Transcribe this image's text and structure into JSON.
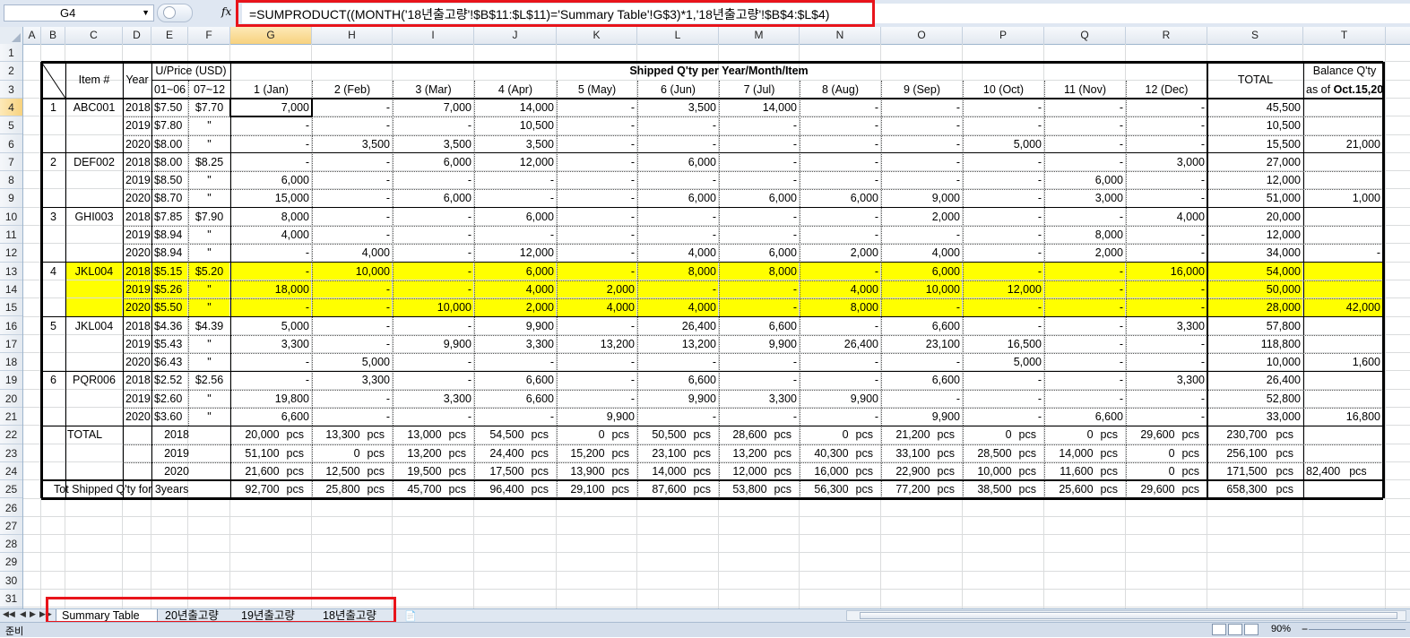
{
  "formula_bar": {
    "name_box": "G4",
    "fx_label": "fx",
    "formula": "=SUMPRODUCT((MONTH('18년출고량'!$B$11:$L$11)='Summary Table'!G$3)*1,'18년출고량'!$B$4:$L$4)"
  },
  "columns": [
    "A",
    "B",
    "C",
    "D",
    "E",
    "F",
    "G",
    "H",
    "I",
    "J",
    "K",
    "L",
    "M",
    "N",
    "O",
    "P",
    "Q",
    "R",
    "S",
    "T"
  ],
  "rows": [
    "1",
    "2",
    "3",
    "4",
    "5",
    "6",
    "7",
    "8",
    "9",
    "10",
    "11",
    "12",
    "13",
    "14",
    "15",
    "16",
    "17",
    "18",
    "19",
    "20",
    "21",
    "22",
    "23",
    "24",
    "25",
    "26",
    "27",
    "28",
    "29",
    "30",
    "31"
  ],
  "selected": {
    "column": "G",
    "row": "4"
  },
  "table": {
    "header": {
      "item_no": "Item #",
      "year": "Year",
      "uprice": "U/Price (USD)",
      "uprice_sub1": "01~06",
      "uprice_sub2": "07~12",
      "shipped_title": "Shipped Q'ty per Year/Month/Item",
      "months": [
        "1 (Jan)",
        "2 (Feb)",
        "3 (Mar)",
        "4 (Apr)",
        "5 (May)",
        "6 (Jun)",
        "7 (Jul)",
        "8 (Aug)",
        "9 (Sep)",
        "10 (Oct)",
        "11 (Nov)",
        "12 (Dec)"
      ],
      "total": "TOTAL",
      "balance": "Balance Q'ty",
      "balance_asof_prefix": "as of ",
      "balance_asof_date": "Oct.15,20"
    },
    "rows": [
      {
        "no": "1",
        "item": "ABC001",
        "year": "2018",
        "p1": "$7.50",
        "p2": "$7.70",
        "m": [
          "7,000",
          "-",
          "7,000",
          "14,000",
          "-",
          "3,500",
          "14,000",
          "-",
          "-",
          "-",
          "-",
          "-"
        ],
        "total": "45,500",
        "bal": ""
      },
      {
        "no": "",
        "item": "",
        "year": "2019",
        "p1": "$7.80",
        "p2": "\"",
        "m": [
          "-",
          "-",
          "-",
          "10,500",
          "-",
          "-",
          "-",
          "-",
          "-",
          "-",
          "-",
          "-"
        ],
        "total": "10,500",
        "bal": ""
      },
      {
        "no": "",
        "item": "",
        "year": "2020",
        "p1": "$8.00",
        "p2": "\"",
        "m": [
          "-",
          "3,500",
          "3,500",
          "3,500",
          "-",
          "-",
          "-",
          "-",
          "-",
          "5,000",
          "-",
          "-"
        ],
        "total": "15,500",
        "bal": "21,000"
      },
      {
        "no": "2",
        "item": "DEF002",
        "year": "2018",
        "p1": "$8.00",
        "p2": "$8.25",
        "m": [
          "-",
          "-",
          "6,000",
          "12,000",
          "-",
          "6,000",
          "-",
          "-",
          "-",
          "-",
          "-",
          "3,000"
        ],
        "total": "27,000",
        "bal": ""
      },
      {
        "no": "",
        "item": "",
        "year": "2019",
        "p1": "$8.50",
        "p2": "\"",
        "m": [
          "6,000",
          "-",
          "-",
          "-",
          "-",
          "-",
          "-",
          "-",
          "-",
          "-",
          "6,000",
          "-"
        ],
        "total": "12,000",
        "bal": ""
      },
      {
        "no": "",
        "item": "",
        "year": "2020",
        "p1": "$8.70",
        "p2": "\"",
        "m": [
          "15,000",
          "-",
          "6,000",
          "-",
          "-",
          "6,000",
          "6,000",
          "6,000",
          "9,000",
          "-",
          "3,000",
          "-"
        ],
        "total": "51,000",
        "bal": "1,000"
      },
      {
        "no": "3",
        "item": "GHI003",
        "year": "2018",
        "p1": "$7.85",
        "p2": "$7.90",
        "m": [
          "8,000",
          "-",
          "-",
          "6,000",
          "-",
          "-",
          "-",
          "-",
          "2,000",
          "-",
          "-",
          "4,000"
        ],
        "total": "20,000",
        "bal": ""
      },
      {
        "no": "",
        "item": "",
        "year": "2019",
        "p1": "$8.94",
        "p2": "\"",
        "m": [
          "4,000",
          "-",
          "-",
          "-",
          "-",
          "-",
          "-",
          "-",
          "-",
          "-",
          "8,000",
          "-"
        ],
        "total": "12,000",
        "bal": ""
      },
      {
        "no": "",
        "item": "",
        "year": "2020",
        "p1": "$8.94",
        "p2": "\"",
        "m": [
          "-",
          "4,000",
          "-",
          "12,000",
          "-",
          "4,000",
          "6,000",
          "2,000",
          "4,000",
          "-",
          "2,000",
          "-"
        ],
        "total": "34,000",
        "bal": "-"
      },
      {
        "no": "4",
        "item": "JKL004",
        "year": "2018",
        "p1": "$5.15",
        "p2": "$5.20",
        "m": [
          "-",
          "10,000",
          "-",
          "6,000",
          "-",
          "8,000",
          "8,000",
          "-",
          "6,000",
          "-",
          "-",
          "16,000"
        ],
        "total": "54,000",
        "bal": ""
      },
      {
        "no": "",
        "item": "",
        "year": "2019",
        "p1": "$5.26",
        "p2": "\"",
        "m": [
          "18,000",
          "-",
          "-",
          "4,000",
          "2,000",
          "-",
          "-",
          "4,000",
          "10,000",
          "12,000",
          "-",
          "-"
        ],
        "total": "50,000",
        "bal": ""
      },
      {
        "no": "",
        "item": "",
        "year": "2020",
        "p1": "$5.50",
        "p2": "\"",
        "m": [
          "-",
          "-",
          "10,000",
          "2,000",
          "4,000",
          "4,000",
          "-",
          "8,000",
          "-",
          "-",
          "-",
          "-"
        ],
        "total": "28,000",
        "bal": "42,000"
      },
      {
        "no": "5",
        "item": "JKL004",
        "year": "2018",
        "p1": "$4.36",
        "p2": "$4.39",
        "m": [
          "5,000",
          "-",
          "-",
          "9,900",
          "-",
          "26,400",
          "6,600",
          "-",
          "6,600",
          "-",
          "-",
          "3,300"
        ],
        "total": "57,800",
        "bal": ""
      },
      {
        "no": "",
        "item": "",
        "year": "2019",
        "p1": "$5.43",
        "p2": "\"",
        "m": [
          "3,300",
          "-",
          "9,900",
          "3,300",
          "13,200",
          "13,200",
          "9,900",
          "26,400",
          "23,100",
          "16,500",
          "-",
          "-"
        ],
        "total": "118,800",
        "bal": ""
      },
      {
        "no": "",
        "item": "",
        "year": "2020",
        "p1": "$6.43",
        "p2": "\"",
        "m": [
          "-",
          "5,000",
          "-",
          "-",
          "-",
          "-",
          "-",
          "-",
          "-",
          "5,000",
          "-",
          "-"
        ],
        "total": "10,000",
        "bal": "1,600"
      },
      {
        "no": "6",
        "item": "PQR006",
        "year": "2018",
        "p1": "$2.52",
        "p2": "$2.56",
        "m": [
          "-",
          "3,300",
          "-",
          "6,600",
          "-",
          "6,600",
          "-",
          "-",
          "6,600",
          "-",
          "-",
          "3,300"
        ],
        "total": "26,400",
        "bal": ""
      },
      {
        "no": "",
        "item": "",
        "year": "2019",
        "p1": "$2.60",
        "p2": "\"",
        "m": [
          "19,800",
          "-",
          "3,300",
          "6,600",
          "-",
          "9,900",
          "3,300",
          "9,900",
          "-",
          "-",
          "-",
          "-"
        ],
        "total": "52,800",
        "bal": ""
      },
      {
        "no": "",
        "item": "",
        "year": "2020",
        "p1": "$3.60",
        "p2": "\"",
        "m": [
          "6,600",
          "-",
          "-",
          "-",
          "9,900",
          "-",
          "-",
          "-",
          "9,900",
          "-",
          "6,600",
          "-"
        ],
        "total": "33,000",
        "bal": "16,800"
      }
    ],
    "totals_label": "TOTAL",
    "unit": "pcs",
    "totals": [
      {
        "year": "2018",
        "m": [
          "20,000",
          "13,300",
          "13,000",
          "54,500",
          "0",
          "50,500",
          "28,600",
          "0",
          "21,200",
          "0",
          "0",
          "29,600"
        ],
        "total": "230,700",
        "bal": ""
      },
      {
        "year": "2019",
        "m": [
          "51,100",
          "0",
          "13,200",
          "24,400",
          "15,200",
          "23,100",
          "13,200",
          "40,300",
          "33,100",
          "28,500",
          "14,000",
          "0"
        ],
        "total": "256,100",
        "bal": ""
      },
      {
        "year": "2020",
        "m": [
          "21,600",
          "12,500",
          "19,500",
          "17,500",
          "13,900",
          "14,000",
          "12,000",
          "16,000",
          "22,900",
          "10,000",
          "11,600",
          "0"
        ],
        "total": "171,500",
        "bal": "82,400"
      }
    ],
    "grand_label": "Tot Shipped Q'ty for 3years",
    "grand": {
      "m": [
        "92,700",
        "25,800",
        "45,700",
        "96,400",
        "29,100",
        "87,600",
        "53,800",
        "56,300",
        "77,200",
        "38,500",
        "25,600",
        "29,600"
      ],
      "total": "658,300"
    }
  },
  "sheet_tabs": [
    "Summary Table",
    "20년출고량",
    "19년출고량",
    "18년출고량"
  ],
  "active_tab": "Summary Table",
  "status": {
    "ready": "준비",
    "zoom": "90%",
    "zoom_minus": "−"
  },
  "colors": {
    "highlight": "#ffff00",
    "annotation": "#e8141b"
  }
}
